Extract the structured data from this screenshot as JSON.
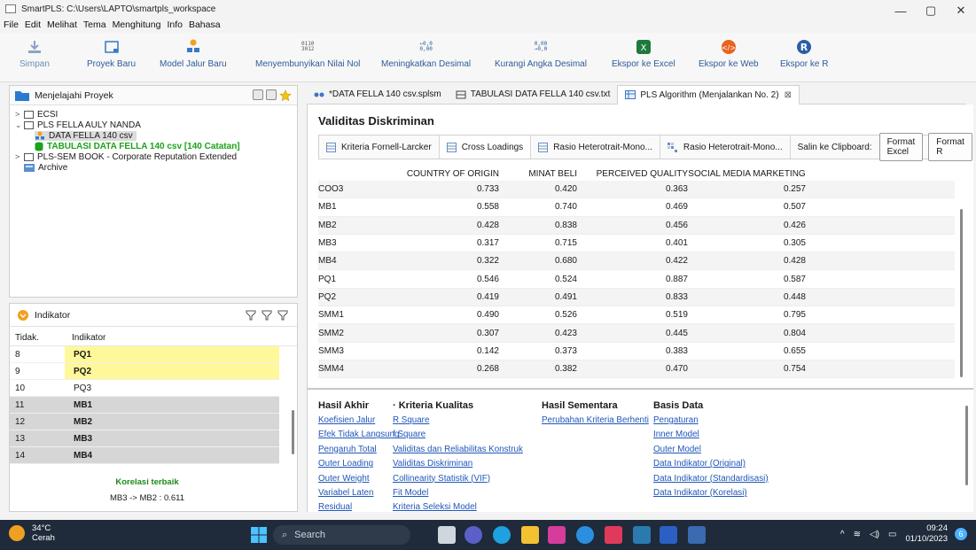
{
  "window": {
    "title": "SmartPLS: C:\\Users\\LAPTO\\smartpls_workspace",
    "minimize": "—",
    "maximize": "▢",
    "close": "✕"
  },
  "menu": [
    "File",
    "Edit",
    "Melihat",
    "Tema",
    "Menghitung",
    "Info",
    "Bahasa"
  ],
  "toolbar": {
    "items": [
      {
        "label": "Simpan",
        "icon": "save-icon"
      },
      {
        "label": "Proyek Baru",
        "icon": "new-project-icon"
      },
      {
        "label": "Model Jalur Baru",
        "icon": "new-path-model-icon"
      },
      {
        "label": "Menyembunyikan Nilai Nol",
        "icon": "hide-zero-icon",
        "icon_text": "0110\n3012"
      },
      {
        "label": "Meningkatkan Desimal",
        "icon": "increase-decimal-icon",
        "icon_text": "←0,0\n0,00"
      },
      {
        "label": "Kurangi Angka Desimal",
        "icon": "decrease-decimal-icon",
        "icon_text": "0,00\n→0,0"
      },
      {
        "label": "Ekspor ke Excel",
        "icon": "excel-icon"
      },
      {
        "label": "Ekspor ke Web",
        "icon": "web-icon"
      },
      {
        "label": "Ekspor ke R",
        "icon": "r-icon"
      }
    ]
  },
  "explorer": {
    "title": "Menjelajahi Proyek",
    "tree": [
      {
        "label": "ECSI"
      },
      {
        "label": "PLS FELLA AULY NANDA"
      },
      {
        "label": "DATA FELLA 140 csv"
      },
      {
        "label": "TABULASI DATA FELLA 140 csv [140 Catatan]"
      },
      {
        "label": "PLS-SEM BOOK - Corporate Reputation Extended"
      },
      {
        "label": "Archive"
      }
    ]
  },
  "indicators": {
    "title": "Indikator",
    "col_no": "Tidak.",
    "col_name": "Indikator",
    "rows": [
      {
        "no": "8",
        "name": "PQ1"
      },
      {
        "no": "9",
        "name": "PQ2"
      },
      {
        "no": "10",
        "name": "PQ3"
      },
      {
        "no": "11",
        "name": "MB1"
      },
      {
        "no": "12",
        "name": "MB2"
      },
      {
        "no": "13",
        "name": "MB3"
      },
      {
        "no": "14",
        "name": "MB4"
      }
    ],
    "corr_title": "Korelasi terbaik",
    "corr_value": "MB3 -> MB2 : 0.611"
  },
  "editor_tabs": [
    {
      "label": "*DATA FELLA 140 csv.splsm"
    },
    {
      "label": "TABULASI DATA FELLA 140 csv.txt"
    },
    {
      "label": "PLS Algorithm (Menjalankan No. 2)",
      "close": "⊠"
    }
  ],
  "main": {
    "title": "Validitas Diskriminan",
    "subtabs": [
      {
        "label": "Kriteria Fornell-Larcker"
      },
      {
        "label": "Cross Loadings"
      },
      {
        "label": "Rasio Heterotrait-Mono..."
      },
      {
        "label": "Rasio Heterotrait-Mono..."
      }
    ],
    "clipboard": "Salin ke Clipboard:",
    "btn_excel": "Format Excel",
    "btn_r": "Format R"
  },
  "table": {
    "columns": [
      "COUNTRY OF ORIGIN",
      "MINAT BELI",
      "PERCEIVED QUALITY",
      "SOCIAL MEDIA MARKETING"
    ],
    "rows": [
      {
        "name": "COO3",
        "v": [
          "0.733",
          "0.420",
          "0.363",
          "0.257"
        ]
      },
      {
        "name": "MB1",
        "v": [
          "0.558",
          "0.740",
          "0.469",
          "0.507"
        ]
      },
      {
        "name": "MB2",
        "v": [
          "0.428",
          "0.838",
          "0.456",
          "0.426"
        ]
      },
      {
        "name": "MB3",
        "v": [
          "0.317",
          "0.715",
          "0.401",
          "0.305"
        ]
      },
      {
        "name": "MB4",
        "v": [
          "0.322",
          "0.680",
          "0.422",
          "0.428"
        ]
      },
      {
        "name": "PQ1",
        "v": [
          "0.546",
          "0.524",
          "0.887",
          "0.587"
        ]
      },
      {
        "name": "PQ2",
        "v": [
          "0.419",
          "0.491",
          "0.833",
          "0.448"
        ]
      },
      {
        "name": "SMM1",
        "v": [
          "0.490",
          "0.526",
          "0.519",
          "0.795"
        ]
      },
      {
        "name": "SMM2",
        "v": [
          "0.307",
          "0.423",
          "0.445",
          "0.804"
        ]
      },
      {
        "name": "SMM3",
        "v": [
          "0.142",
          "0.373",
          "0.383",
          "0.655"
        ]
      },
      {
        "name": "SMM4",
        "v": [
          "0.268",
          "0.382",
          "0.470",
          "0.754"
        ]
      }
    ]
  },
  "links": {
    "hasil_akhir": {
      "title": "Hasil Akhir",
      "items": [
        "Koefisien Jalur",
        "Efek Tidak Langsung",
        "Pengaruh Total",
        "Outer Loading",
        "Outer Weight",
        "Variabel Laten",
        "Residual"
      ]
    },
    "kriteria": {
      "title": "· Kriteria Kualitas",
      "items": [
        "R Square",
        "f Square",
        "Validitas dan Reliabilitas Konstruk",
        "Validitas Diskriminan",
        "Collinearity Statistik (VIF)",
        "Fit Model",
        "Kriteria Seleksi Model"
      ]
    },
    "sementara": {
      "title": "Hasil Sementara",
      "items": [
        "Perubahan Kriteria Berhenti"
      ]
    },
    "basis": {
      "title": "Basis Data",
      "items": [
        "Pengaturan",
        "Inner Model",
        "Outer Model",
        "Data Indikator (Original)",
        "Data Indikator (Standardisasi)",
        "Data Indikator (Korelasi)"
      ]
    }
  },
  "taskbar": {
    "temp": "34°C",
    "weather": "Cerah",
    "search": "Search",
    "time": "09:24",
    "date": "01/10/2023",
    "notifications": "6"
  },
  "colors": {
    "accent_blue": "#1f56b8",
    "highlight_yellow": "#fff89a",
    "green": "#1aa31a",
    "taskbar": "#1f2a3a"
  }
}
